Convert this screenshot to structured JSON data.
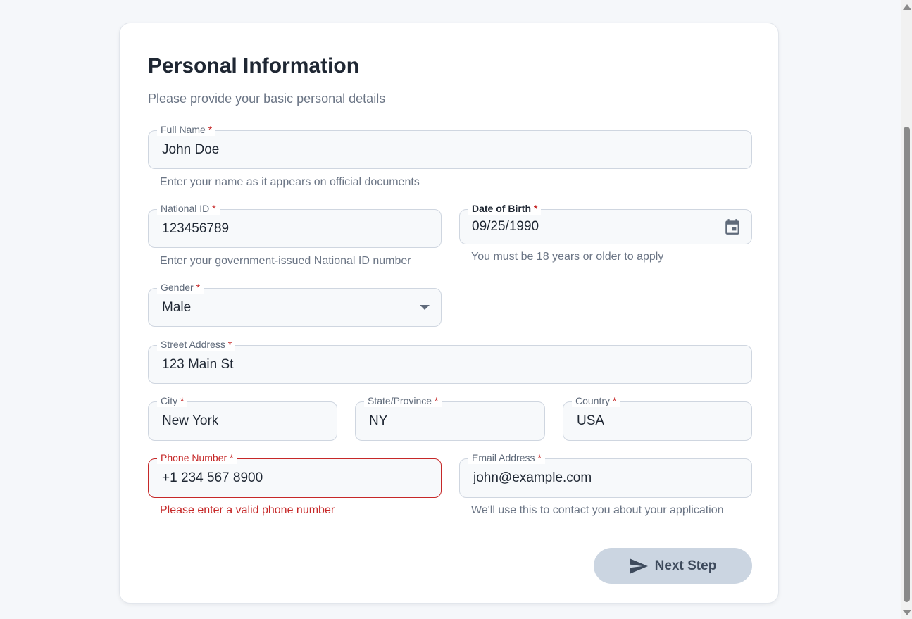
{
  "form": {
    "title": "Personal Information",
    "subtitle": "Please provide your basic personal details",
    "required_mark": "*",
    "full_name": {
      "label": "Full Name",
      "value": "John Doe",
      "helper": "Enter your name as it appears on official documents"
    },
    "national_id": {
      "label": "National ID",
      "value": "123456789",
      "helper": "Enter your government-issued National ID number"
    },
    "date_of_birth": {
      "label": "Date of Birth",
      "value": "09/25/1990",
      "helper": "You must be 18 years or older to apply",
      "icon": "calendar-icon"
    },
    "gender": {
      "label": "Gender",
      "value": "Male",
      "icon": "dropdown-arrow-icon"
    },
    "street_address": {
      "label": "Street Address",
      "value": "123 Main St"
    },
    "city": {
      "label": "City",
      "value": "New York"
    },
    "state": {
      "label": "State/Province",
      "value": "NY"
    },
    "country": {
      "label": "Country",
      "value": "USA"
    },
    "phone": {
      "label": "Phone Number",
      "value": "+1 234 567 8900",
      "error": "Please enter a valid phone number"
    },
    "email": {
      "label": "Email Address",
      "value": "john@example.com",
      "helper": "We'll use this to contact you about your application"
    },
    "next_button": {
      "label": "Next Step",
      "icon": "send-icon"
    }
  },
  "colors": {
    "error": "#c62828",
    "button_bg": "#cbd5e1",
    "text_primary": "#1f2733",
    "text_secondary": "#6b7585"
  }
}
